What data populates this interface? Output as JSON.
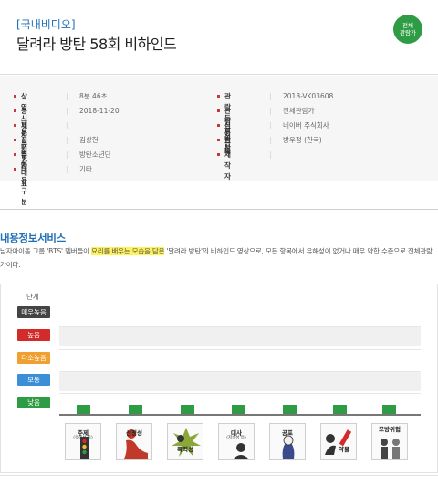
{
  "header": {
    "category": "[국내비디오]",
    "title": "달려라 방탄 58회 비하인드",
    "rating_badge": "전체\n관람가",
    "rating_color": "#2e9b45"
  },
  "info": [
    {
      "label": "상영시간",
      "value": "8분 46초"
    },
    {
      "label": "관람등급번호",
      "value": "2018-VK03608"
    },
    {
      "label": "등급분류일자",
      "value": "2018-11-20"
    },
    {
      "label": "관람등급",
      "value": "전체관람가"
    },
    {
      "label": "제작년도",
      "value": ""
    },
    {
      "label": "신청사",
      "value": "네이버 주식회사"
    },
    {
      "label": "신청사대표",
      "value": "김상헌"
    },
    {
      "label": "감독",
      "value": "방우정 (한국)"
    },
    {
      "label": "주연",
      "value": "방탄소년단"
    },
    {
      "label": "제작자",
      "value": ""
    },
    {
      "label": "내용구분",
      "value": "기타"
    }
  ],
  "info_separator": "|",
  "content_service": {
    "title": "내용정보서비스",
    "desc_part1": "남자아이돌 그룹 'BTS' 멤버들이 ",
    "desc_highlight": "요리를 배우는 모습을 담은",
    "desc_part2": " '달려라 방탄'의 비하인드 영상으로, 모든 항목에서 유해성이 없거나 매우 약한 수준으로 전체관람가이다."
  },
  "chart_data": {
    "type": "bar",
    "title": "",
    "y_header": "단계",
    "levels": [
      "매우높음",
      "높음",
      "다소높음",
      "보통",
      "낮음"
    ],
    "level_colors": [
      "#444444",
      "#d32a2a",
      "#f0a030",
      "#3b8fd6",
      "#2e9b45"
    ],
    "categories": [
      {
        "name": "주제",
        "sub": "(유해성 등)"
      },
      {
        "name": "선정성",
        "sub": ""
      },
      {
        "name": "폭력성",
        "sub": ""
      },
      {
        "name": "대사",
        "sub": "(저속성 등)"
      },
      {
        "name": "공포",
        "sub": ""
      },
      {
        "name": "약물",
        "sub": ""
      },
      {
        "name": "모방위험",
        "sub": ""
      }
    ],
    "values": [
      "낮음",
      "낮음",
      "낮음",
      "낮음",
      "낮음",
      "낮음",
      "낮음"
    ],
    "bar_color": "#2e9b45"
  }
}
